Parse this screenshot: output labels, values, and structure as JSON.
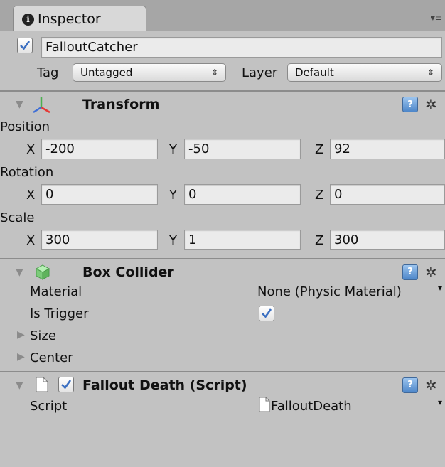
{
  "tab": {
    "title": "Inspector",
    "menu_glyph": "▾≡"
  },
  "object": {
    "active": true,
    "name": "FalloutCatcher"
  },
  "tag": {
    "label": "Tag",
    "value": "Untagged"
  },
  "layer": {
    "label": "Layer",
    "value": "Default"
  },
  "transform": {
    "title": "Transform",
    "position": {
      "label": "Position",
      "x": "-200",
      "y": "-50",
      "z": "92"
    },
    "rotation": {
      "label": "Rotation",
      "x": "0",
      "y": "0",
      "z": "0"
    },
    "scale": {
      "label": "Scale",
      "x": "300",
      "y": "1",
      "z": "300"
    }
  },
  "axes": {
    "x": "X",
    "y": "Y",
    "z": "Z"
  },
  "box_collider": {
    "title": "Box Collider",
    "material_label": "Material",
    "material_value": "None (Physic Material)",
    "is_trigger_label": "Is Trigger",
    "is_trigger": true,
    "size_label": "Size",
    "center_label": "Center"
  },
  "script_component": {
    "title": "Fallout Death (Script)",
    "enabled": true,
    "script_label": "Script",
    "script_value": "FalloutDeath"
  },
  "icons": {
    "help": "?",
    "gear": "✲",
    "fold_open": "▼",
    "fold_closed": "▶",
    "small_arrow": "▾",
    "dropdown_arrows": "⇕"
  },
  "colors": {
    "background": "#c2c2c2",
    "tabbar": "#a6a6a6",
    "help_icon": "#4d86c9",
    "checkmark": "#3b6fc1"
  }
}
